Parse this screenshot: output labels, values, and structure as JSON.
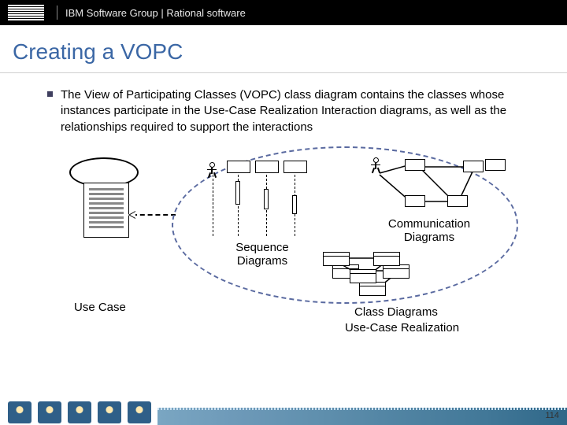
{
  "header": {
    "brand": "IBM",
    "title": "IBM Software Group | Rational software"
  },
  "slide": {
    "title": "Creating a VOPC"
  },
  "bullet": "The View of Participating Classes (VOPC) class diagram contains the classes whose instances participate in the Use-Case Realization Interaction diagrams, as well as the relationships required to support the interactions",
  "labels": {
    "usecase": "Use Case",
    "sequence": "Sequence Diagrams",
    "communication": "Communication Diagrams",
    "classdiag": "Class Diagrams",
    "ucr": "Use-Case Realization"
  },
  "page": "114"
}
